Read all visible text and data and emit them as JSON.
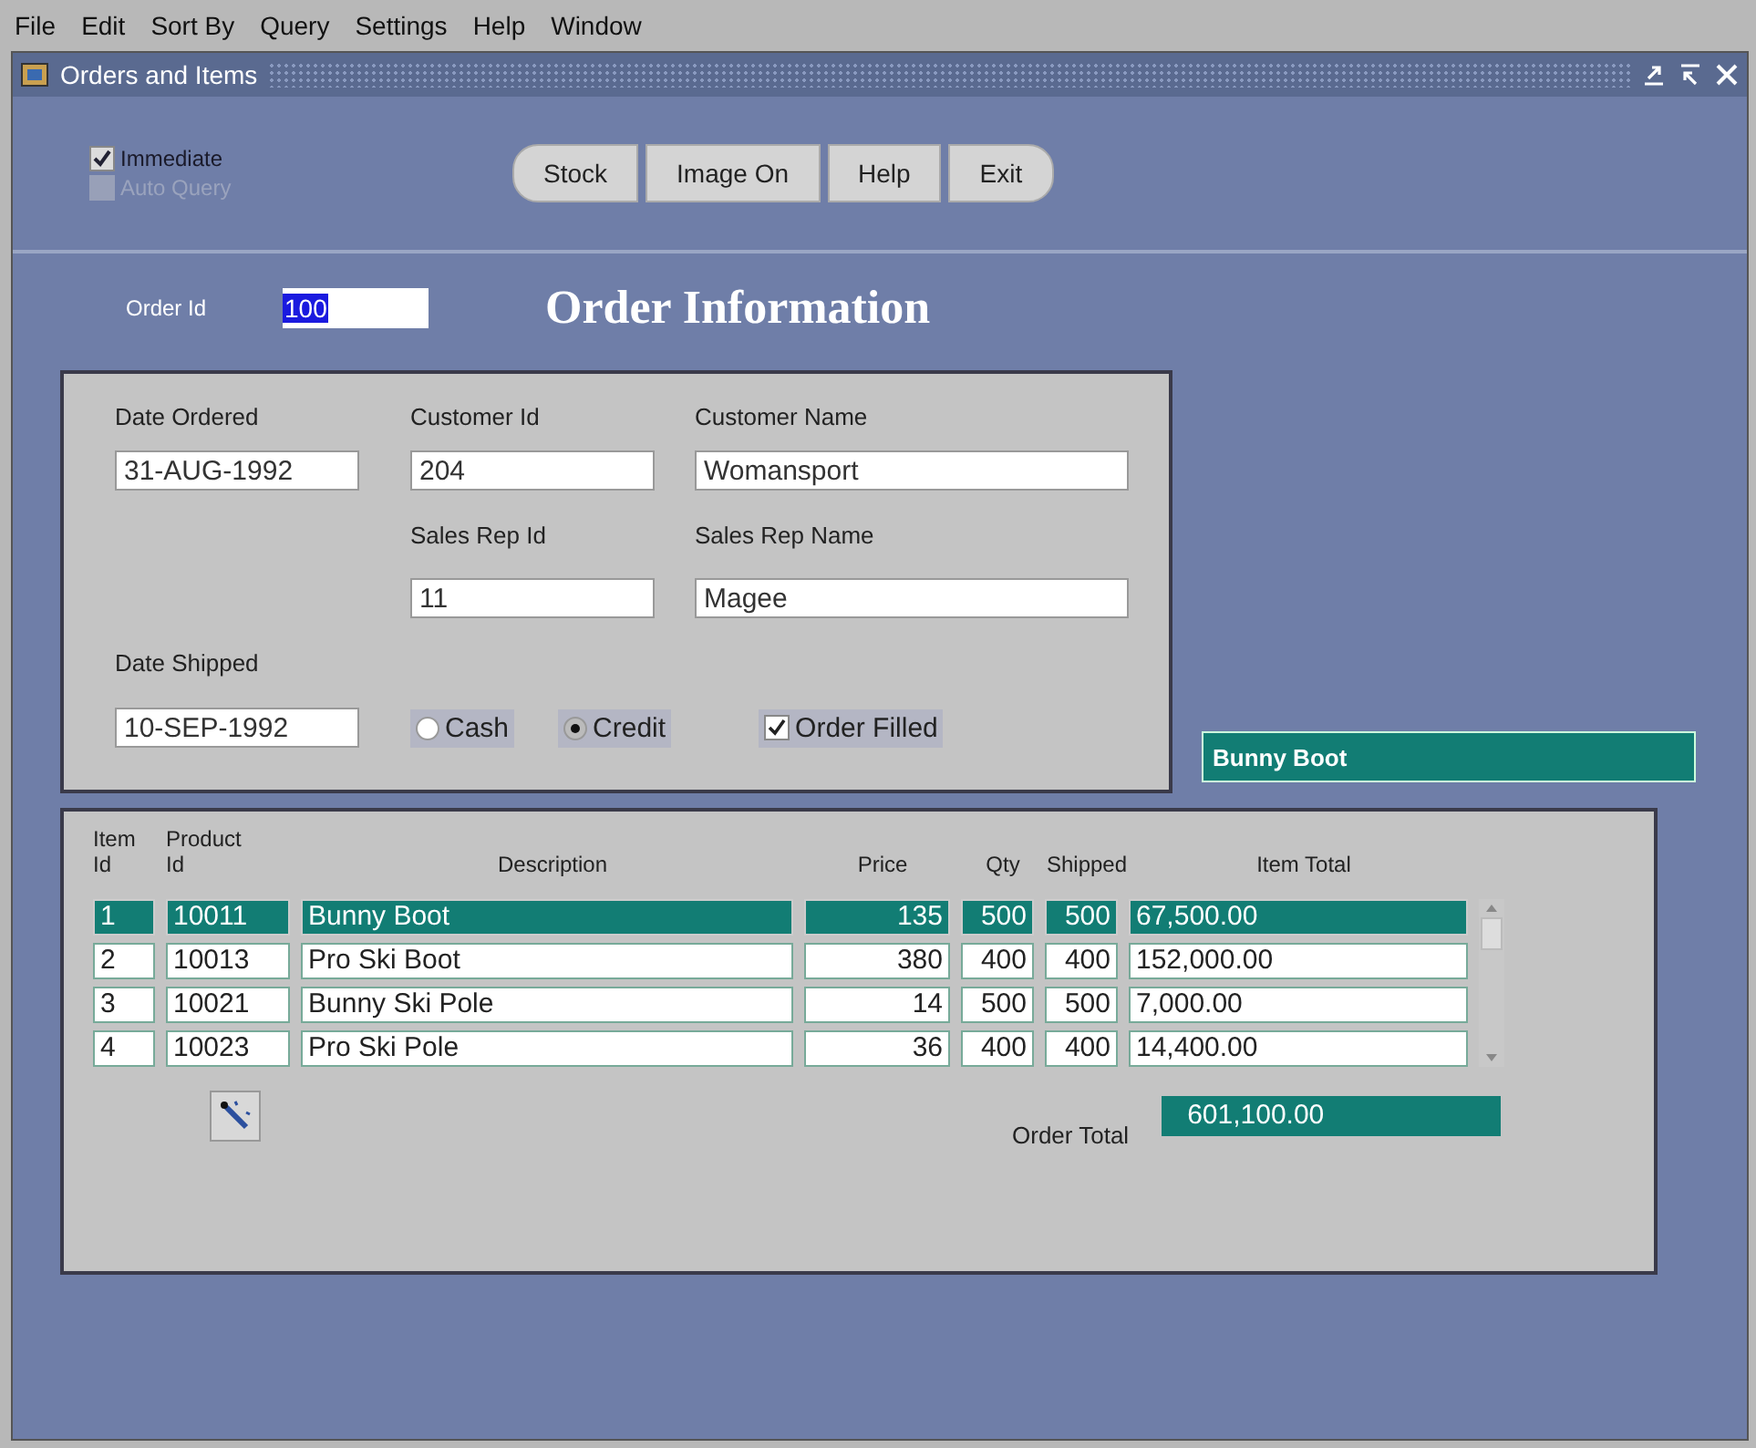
{
  "menu": [
    "File",
    "Edit",
    "Sort By",
    "Query",
    "Settings",
    "Help",
    "Window"
  ],
  "window": {
    "title": "Orders and Items"
  },
  "toolbar": {
    "checkboxes": [
      {
        "label": "Immediate",
        "checked": true,
        "disabled": false
      },
      {
        "label": "Auto Query",
        "checked": false,
        "disabled": true
      }
    ],
    "buttons": [
      "Stock",
      "Image On",
      "Help",
      "Exit"
    ]
  },
  "order_id": {
    "label": "Order Id",
    "value": "100"
  },
  "heading": "Order Information",
  "order": {
    "date_ordered": {
      "label": "Date Ordered",
      "value": "31-AUG-1992"
    },
    "customer_id": {
      "label": "Customer Id",
      "value": "204"
    },
    "customer_name": {
      "label": "Customer Name",
      "value": "Womansport"
    },
    "sales_rep_id": {
      "label": "Sales Rep Id",
      "value": "11"
    },
    "sales_rep_name": {
      "label": "Sales Rep Name",
      "value": "Magee"
    },
    "date_shipped": {
      "label": "Date Shipped",
      "value": "10-SEP-1992"
    },
    "payment": [
      {
        "label": "Cash",
        "selected": false
      },
      {
        "label": "Credit",
        "selected": true
      }
    ],
    "order_filled": {
      "label": "Order Filled",
      "checked": true
    }
  },
  "description_display": "Bunny Boot",
  "items": {
    "columns": [
      "Item\nId",
      "Product\nId",
      "Description",
      "Price",
      "Qty",
      "Shipped",
      "Item Total"
    ],
    "rows": [
      {
        "cells": [
          "1",
          "10011",
          "Bunny Boot",
          "135",
          "500",
          "500",
          "67,500.00"
        ],
        "selected": true
      },
      {
        "cells": [
          "2",
          "10013",
          "Pro Ski Boot",
          "380",
          "400",
          "400",
          "152,000.00"
        ],
        "selected": false
      },
      {
        "cells": [
          "3",
          "10021",
          "Bunny Ski Pole",
          "14",
          "500",
          "500",
          "7,000.00"
        ],
        "selected": false
      },
      {
        "cells": [
          "4",
          "10023",
          "Pro Ski Pole",
          "36",
          "400",
          "400",
          "14,400.00"
        ],
        "selected": false
      }
    ],
    "order_total": {
      "label": "Order Total",
      "value": "601,100.00"
    }
  }
}
